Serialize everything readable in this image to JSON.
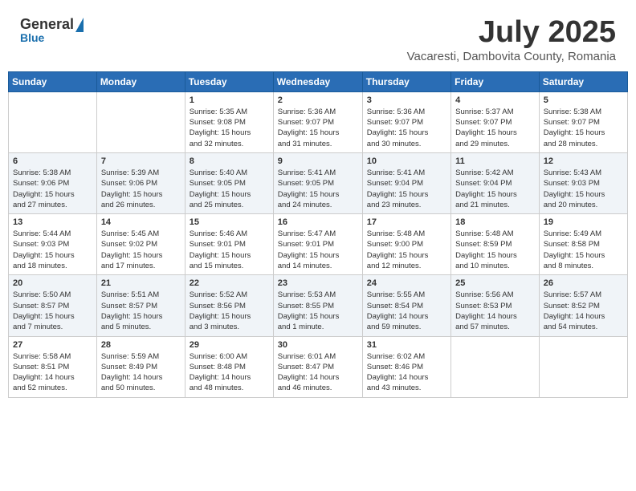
{
  "header": {
    "logo_general": "General",
    "logo_blue": "Blue",
    "month_title": "July 2025",
    "subtitle": "Vacaresti, Dambovita County, Romania"
  },
  "calendar": {
    "days_of_week": [
      "Sunday",
      "Monday",
      "Tuesday",
      "Wednesday",
      "Thursday",
      "Friday",
      "Saturday"
    ],
    "weeks": [
      [
        {
          "day": "",
          "info": ""
        },
        {
          "day": "",
          "info": ""
        },
        {
          "day": "1",
          "info": "Sunrise: 5:35 AM\nSunset: 9:08 PM\nDaylight: 15 hours\nand 32 minutes."
        },
        {
          "day": "2",
          "info": "Sunrise: 5:36 AM\nSunset: 9:07 PM\nDaylight: 15 hours\nand 31 minutes."
        },
        {
          "day": "3",
          "info": "Sunrise: 5:36 AM\nSunset: 9:07 PM\nDaylight: 15 hours\nand 30 minutes."
        },
        {
          "day": "4",
          "info": "Sunrise: 5:37 AM\nSunset: 9:07 PM\nDaylight: 15 hours\nand 29 minutes."
        },
        {
          "day": "5",
          "info": "Sunrise: 5:38 AM\nSunset: 9:07 PM\nDaylight: 15 hours\nand 28 minutes."
        }
      ],
      [
        {
          "day": "6",
          "info": "Sunrise: 5:38 AM\nSunset: 9:06 PM\nDaylight: 15 hours\nand 27 minutes."
        },
        {
          "day": "7",
          "info": "Sunrise: 5:39 AM\nSunset: 9:06 PM\nDaylight: 15 hours\nand 26 minutes."
        },
        {
          "day": "8",
          "info": "Sunrise: 5:40 AM\nSunset: 9:05 PM\nDaylight: 15 hours\nand 25 minutes."
        },
        {
          "day": "9",
          "info": "Sunrise: 5:41 AM\nSunset: 9:05 PM\nDaylight: 15 hours\nand 24 minutes."
        },
        {
          "day": "10",
          "info": "Sunrise: 5:41 AM\nSunset: 9:04 PM\nDaylight: 15 hours\nand 23 minutes."
        },
        {
          "day": "11",
          "info": "Sunrise: 5:42 AM\nSunset: 9:04 PM\nDaylight: 15 hours\nand 21 minutes."
        },
        {
          "day": "12",
          "info": "Sunrise: 5:43 AM\nSunset: 9:03 PM\nDaylight: 15 hours\nand 20 minutes."
        }
      ],
      [
        {
          "day": "13",
          "info": "Sunrise: 5:44 AM\nSunset: 9:03 PM\nDaylight: 15 hours\nand 18 minutes."
        },
        {
          "day": "14",
          "info": "Sunrise: 5:45 AM\nSunset: 9:02 PM\nDaylight: 15 hours\nand 17 minutes."
        },
        {
          "day": "15",
          "info": "Sunrise: 5:46 AM\nSunset: 9:01 PM\nDaylight: 15 hours\nand 15 minutes."
        },
        {
          "day": "16",
          "info": "Sunrise: 5:47 AM\nSunset: 9:01 PM\nDaylight: 15 hours\nand 14 minutes."
        },
        {
          "day": "17",
          "info": "Sunrise: 5:48 AM\nSunset: 9:00 PM\nDaylight: 15 hours\nand 12 minutes."
        },
        {
          "day": "18",
          "info": "Sunrise: 5:48 AM\nSunset: 8:59 PM\nDaylight: 15 hours\nand 10 minutes."
        },
        {
          "day": "19",
          "info": "Sunrise: 5:49 AM\nSunset: 8:58 PM\nDaylight: 15 hours\nand 8 minutes."
        }
      ],
      [
        {
          "day": "20",
          "info": "Sunrise: 5:50 AM\nSunset: 8:57 PM\nDaylight: 15 hours\nand 7 minutes."
        },
        {
          "day": "21",
          "info": "Sunrise: 5:51 AM\nSunset: 8:57 PM\nDaylight: 15 hours\nand 5 minutes."
        },
        {
          "day": "22",
          "info": "Sunrise: 5:52 AM\nSunset: 8:56 PM\nDaylight: 15 hours\nand 3 minutes."
        },
        {
          "day": "23",
          "info": "Sunrise: 5:53 AM\nSunset: 8:55 PM\nDaylight: 15 hours\nand 1 minute."
        },
        {
          "day": "24",
          "info": "Sunrise: 5:55 AM\nSunset: 8:54 PM\nDaylight: 14 hours\nand 59 minutes."
        },
        {
          "day": "25",
          "info": "Sunrise: 5:56 AM\nSunset: 8:53 PM\nDaylight: 14 hours\nand 57 minutes."
        },
        {
          "day": "26",
          "info": "Sunrise: 5:57 AM\nSunset: 8:52 PM\nDaylight: 14 hours\nand 54 minutes."
        }
      ],
      [
        {
          "day": "27",
          "info": "Sunrise: 5:58 AM\nSunset: 8:51 PM\nDaylight: 14 hours\nand 52 minutes."
        },
        {
          "day": "28",
          "info": "Sunrise: 5:59 AM\nSunset: 8:49 PM\nDaylight: 14 hours\nand 50 minutes."
        },
        {
          "day": "29",
          "info": "Sunrise: 6:00 AM\nSunset: 8:48 PM\nDaylight: 14 hours\nand 48 minutes."
        },
        {
          "day": "30",
          "info": "Sunrise: 6:01 AM\nSunset: 8:47 PM\nDaylight: 14 hours\nand 46 minutes."
        },
        {
          "day": "31",
          "info": "Sunrise: 6:02 AM\nSunset: 8:46 PM\nDaylight: 14 hours\nand 43 minutes."
        },
        {
          "day": "",
          "info": ""
        },
        {
          "day": "",
          "info": ""
        }
      ]
    ]
  }
}
